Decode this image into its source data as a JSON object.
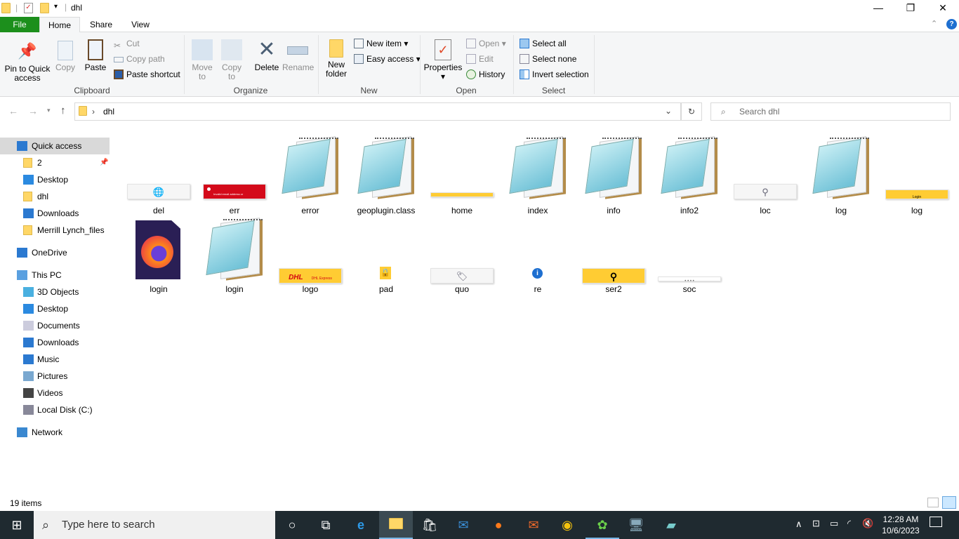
{
  "window": {
    "title": "dhl",
    "minimize": "—",
    "maximize": "❐",
    "close": "✕"
  },
  "tabs": [
    "File",
    "Home",
    "Share",
    "View"
  ],
  "ribbon": {
    "clipboard": {
      "label": "Clipboard",
      "pin": "Pin to Quick access",
      "copy": "Copy",
      "paste": "Paste",
      "cut": "Cut",
      "copy_path": "Copy path",
      "paste_shortcut": "Paste shortcut"
    },
    "organize": {
      "label": "Organize",
      "move_to": "Move to",
      "copy_to": "Copy to",
      "delete": "Delete",
      "rename": "Rename"
    },
    "new": {
      "label": "New",
      "new_folder": "New folder",
      "new_item": "New item",
      "easy_access": "Easy access"
    },
    "open": {
      "label": "Open",
      "properties": "Properties",
      "open": "Open",
      "edit": "Edit",
      "history": "History"
    },
    "select": {
      "label": "Select",
      "select_all": "Select all",
      "select_none": "Select none",
      "invert": "Invert selection"
    }
  },
  "address": {
    "path": "dhl",
    "search_placeholder": "Search dhl"
  },
  "nav": [
    {
      "label": "Quick access",
      "icon": "star-icon",
      "indent": 0,
      "selected": true
    },
    {
      "label": "2",
      "icon": "folder-icon",
      "indent": 1,
      "pinned": true
    },
    {
      "label": "Desktop",
      "icon": "desktop-icon",
      "indent": 1
    },
    {
      "label": "dhl",
      "icon": "folder-icon",
      "indent": 1
    },
    {
      "label": "Downloads",
      "icon": "download-icon",
      "indent": 1
    },
    {
      "label": "Merrill Lynch_files",
      "icon": "folder-icon",
      "indent": 1
    },
    {
      "label": "OneDrive",
      "icon": "cloud-icon",
      "indent": 0
    },
    {
      "label": "This PC",
      "icon": "pc-icon",
      "indent": 0
    },
    {
      "label": "3D Objects",
      "icon": "cube-icon",
      "indent": 1
    },
    {
      "label": "Desktop",
      "icon": "desktop-icon",
      "indent": 1
    },
    {
      "label": "Documents",
      "icon": "document-icon",
      "indent": 1
    },
    {
      "label": "Downloads",
      "icon": "download-icon",
      "indent": 1
    },
    {
      "label": "Music",
      "icon": "music-icon",
      "indent": 1
    },
    {
      "label": "Pictures",
      "icon": "pictures-icon",
      "indent": 1
    },
    {
      "label": "Videos",
      "icon": "video-icon",
      "indent": 1
    },
    {
      "label": "Local Disk (C:)",
      "icon": "disk-icon",
      "indent": 1
    },
    {
      "label": "Network",
      "icon": "network-icon",
      "indent": 0
    }
  ],
  "files": [
    {
      "name": "del",
      "type": "thumb-del"
    },
    {
      "name": "err",
      "type": "thumb-err",
      "text": "Invalid email address or password"
    },
    {
      "name": "error",
      "type": "notepad"
    },
    {
      "name": "geoplugin.class",
      "type": "notepad"
    },
    {
      "name": "home",
      "type": "thumb-home"
    },
    {
      "name": "index",
      "type": "notepad"
    },
    {
      "name": "info",
      "type": "notepad"
    },
    {
      "name": "info2",
      "type": "notepad"
    },
    {
      "name": "loc",
      "type": "thumb-loc"
    },
    {
      "name": "log",
      "type": "notepad"
    },
    {
      "name": "log",
      "type": "thumb-log",
      "text": "Login"
    },
    {
      "name": "login",
      "type": "firefox"
    },
    {
      "name": "login",
      "type": "notepad"
    },
    {
      "name": "logo",
      "type": "thumb-logo",
      "text": "DHL",
      "text2": "DHL Express"
    },
    {
      "name": "pad",
      "type": "thumb-pad"
    },
    {
      "name": "quo",
      "type": "thumb-quo"
    },
    {
      "name": "re",
      "type": "thumb-re"
    },
    {
      "name": "ser2",
      "type": "thumb-ser2"
    },
    {
      "name": "soc",
      "type": "thumb-soc"
    }
  ],
  "status": {
    "count": "19 items"
  },
  "taskbar": {
    "search_placeholder": "Type here to search",
    "time": "12:28 AM",
    "date": "10/6/2023"
  },
  "colors": {
    "file_tab": "#1c8f1c",
    "selection": "#cce8ff",
    "taskbar": "#1f2a30"
  }
}
